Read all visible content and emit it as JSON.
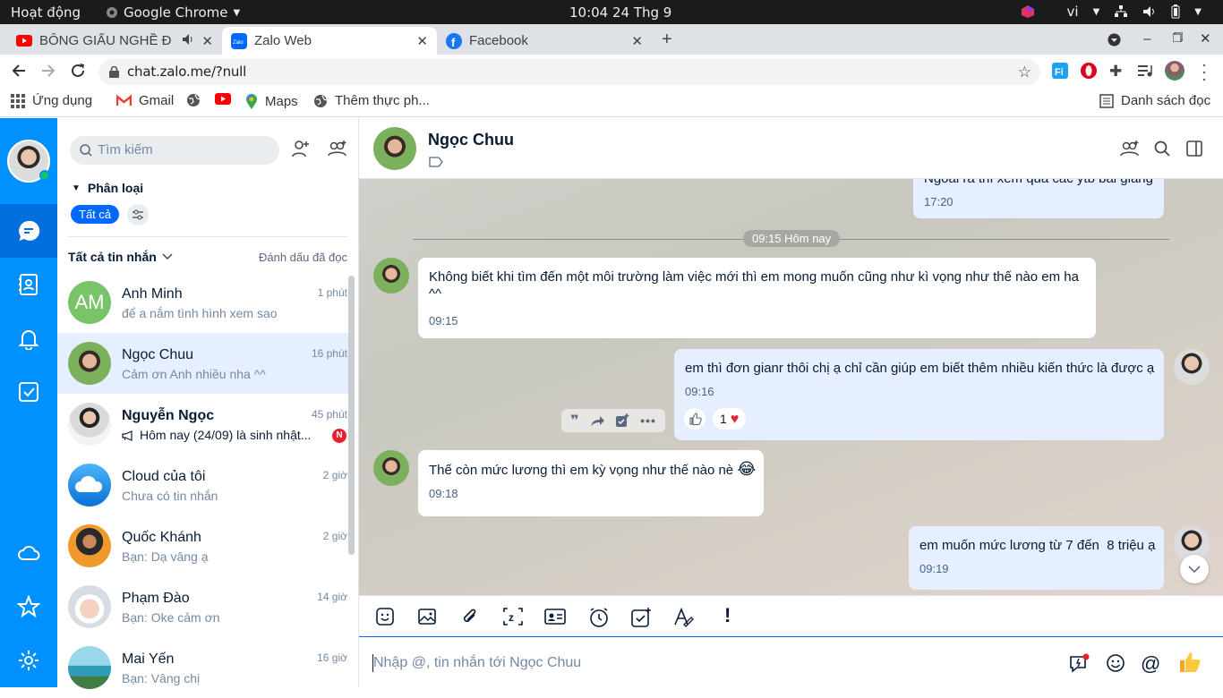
{
  "os": {
    "activities": "Hoạt động",
    "app_name": "Google Chrome",
    "clock": "10:04  24 Thg 9",
    "lang": "vi"
  },
  "browser": {
    "tabs": [
      {
        "title": "BÔNG GIẤU NGHỀ ĐI"
      },
      {
        "title": "Zalo Web"
      },
      {
        "title": "Facebook"
      }
    ],
    "url": "chat.zalo.me/?null",
    "bookmarks": {
      "apps": "Ứng dụng",
      "gmail": "Gmail",
      "maps": "Maps",
      "more": "Thêm thực ph...",
      "reading_list": "Danh sách đọc"
    }
  },
  "sidebar": {
    "search_placeholder": "Tìm kiếm",
    "category_title": "Phân loại",
    "filter_all": "Tất cả",
    "all_messages": "Tất cả tin nhắn",
    "mark_read": "Đánh dấu đã đọc",
    "conversations": [
      {
        "name": "Anh Minh",
        "initials": "AM",
        "time": "1 phút",
        "preview": "để a nắm tình hình xem sao"
      },
      {
        "name": "Ngọc Chuu",
        "time": "16 phút",
        "preview": "Cảm ơn Anh nhiều nha ^^"
      },
      {
        "name": "Nguyễn Ngọc",
        "time": "45 phút",
        "preview": "Hôm nay (24/09) là sinh nhật...",
        "badge": "N"
      },
      {
        "name": "Cloud của tôi",
        "time": "2 giờ",
        "preview": "Chưa có tin nhắn"
      },
      {
        "name": "Quốc Khánh",
        "time": "2 giờ",
        "preview": "Bạn: Dạ vâng ạ"
      },
      {
        "name": "Phạm Đào",
        "time": "14 giờ",
        "preview": "Bạn: Oke cảm ơn"
      },
      {
        "name": "Mai Yến",
        "time": "16 giờ",
        "preview": "Bạn: Vâng chị"
      }
    ]
  },
  "chat": {
    "contact_name": "Ngọc Chuu",
    "date_divider": "09:15 Hôm nay",
    "messages": [
      {
        "dir": "out",
        "text": "Ngoài ra thì xem qua các ytb bài giảng",
        "time": "17:20"
      },
      {
        "dir": "in",
        "text": "Không biết khi tìm đến một môi trường làm việc mới thì em mong muốn cũng như kì vọng như thế nào em ha ^^",
        "time": "09:15"
      },
      {
        "dir": "out",
        "text": "em thì đơn gianr thôi chị ạ chỉ cần giúp em biết thêm nhiều kiến thức là được ạ",
        "time": "09:16",
        "reaction_count": "1"
      },
      {
        "dir": "in",
        "text": "Thế còn mức lương thì em kỳ vọng như thế nào nè",
        "emoji": "😂",
        "time": "09:18"
      },
      {
        "dir": "out",
        "text": "em muốn mức lương từ 7 đến  8 triệu ạ",
        "time": "09:19"
      }
    ],
    "composer_placeholder": "Nhập @, tin nhắn tới Ngọc Chuu"
  },
  "colors": {
    "zalo_blue": "#0091ff",
    "nav_active": "#006edc",
    "bubble_out": "#e5efff",
    "active_conv": "#e5efff"
  }
}
